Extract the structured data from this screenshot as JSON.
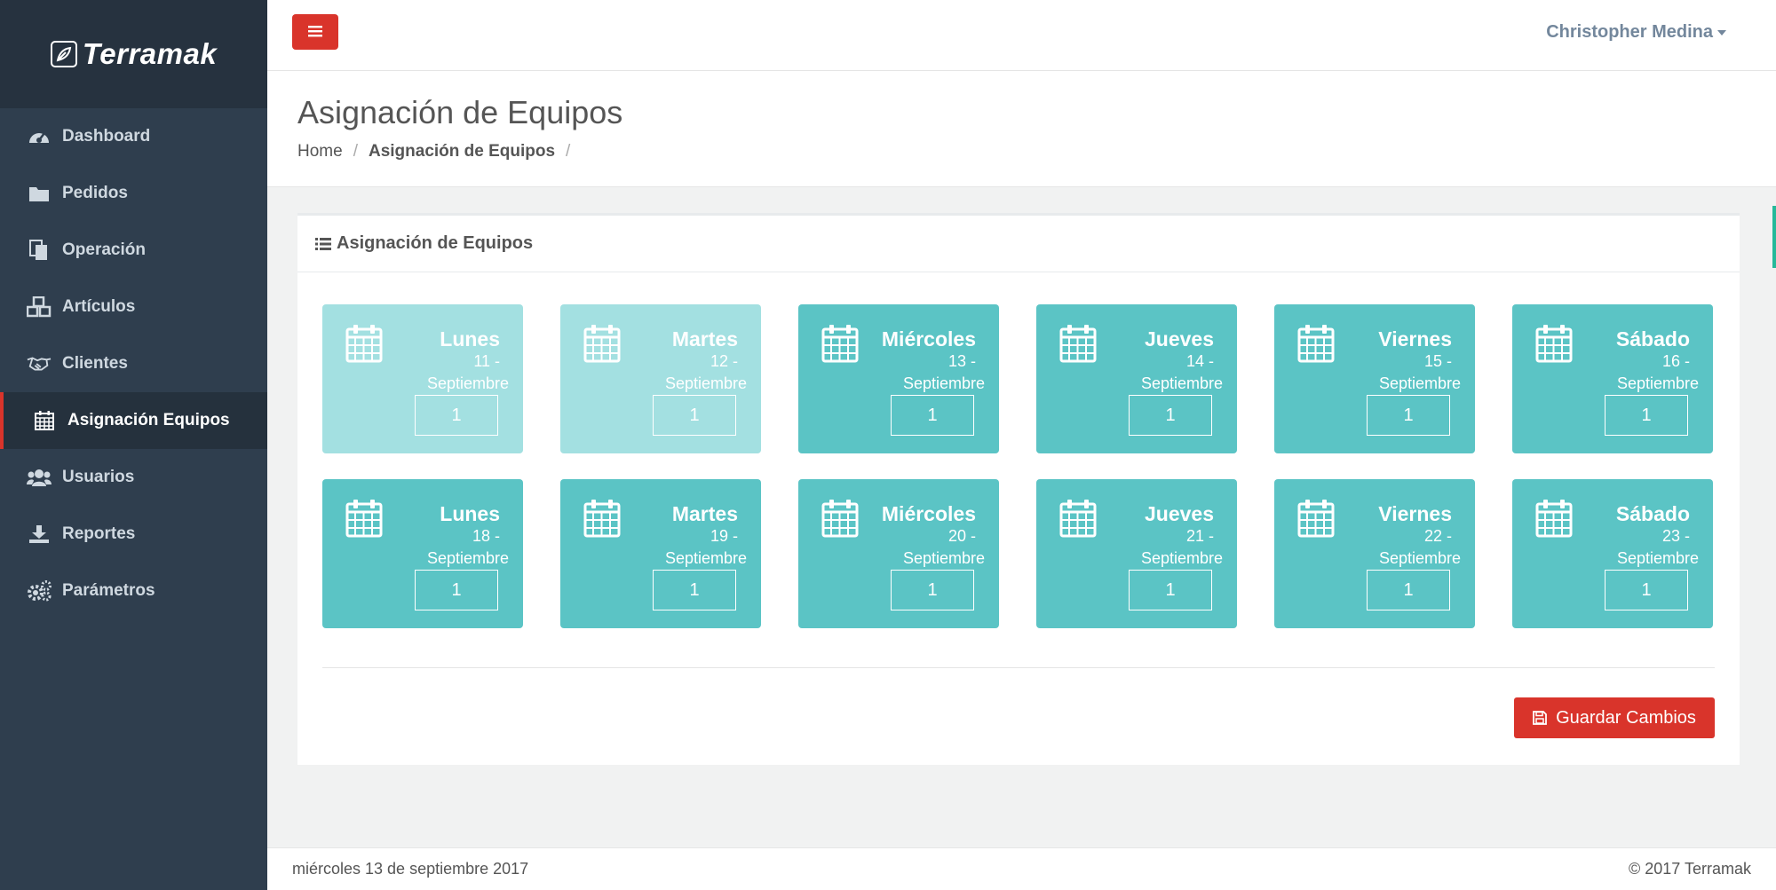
{
  "brand": {
    "name": "Terramak"
  },
  "topbar": {
    "user_name": "Christopher Medina"
  },
  "sidebar": {
    "items": [
      {
        "label": "Dashboard",
        "icon": "dashboard-icon"
      },
      {
        "label": "Pedidos",
        "icon": "folder-icon"
      },
      {
        "label": "Operación",
        "icon": "documents-icon"
      },
      {
        "label": "Artículos",
        "icon": "cubes-icon"
      },
      {
        "label": "Clientes",
        "icon": "handshake-icon"
      },
      {
        "label": "Asignación Equipos",
        "icon": "calendar-icon",
        "active": true
      },
      {
        "label": "Usuarios",
        "icon": "users-icon"
      },
      {
        "label": "Reportes",
        "icon": "download-icon"
      },
      {
        "label": "Parámetros",
        "icon": "gears-icon"
      }
    ]
  },
  "page": {
    "title": "Asignación de Equipos",
    "breadcrumb": {
      "home": "Home",
      "current": "Asignación de Equipos",
      "sep": "/"
    }
  },
  "panel": {
    "title": "Asignación de Equipos",
    "days": [
      {
        "name": "Lunes",
        "num": "11 -",
        "month": "Septiembre",
        "value": "1",
        "past": true
      },
      {
        "name": "Martes",
        "num": "12 -",
        "month": "Septiembre",
        "value": "1",
        "past": true
      },
      {
        "name": "Miércoles",
        "num": "13 -",
        "month": "Septiembre",
        "value": "1",
        "past": false
      },
      {
        "name": "Jueves",
        "num": "14 -",
        "month": "Septiembre",
        "value": "1",
        "past": false
      },
      {
        "name": "Viernes",
        "num": "15 -",
        "month": "Septiembre",
        "value": "1",
        "past": false
      },
      {
        "name": "Sábado",
        "num": "16 -",
        "month": "Septiembre",
        "value": "1",
        "past": false
      },
      {
        "name": "Lunes",
        "num": "18 -",
        "month": "Septiembre",
        "value": "1",
        "past": false
      },
      {
        "name": "Martes",
        "num": "19 -",
        "month": "Septiembre",
        "value": "1",
        "past": false
      },
      {
        "name": "Miércoles",
        "num": "20 -",
        "month": "Septiembre",
        "value": "1",
        "past": false
      },
      {
        "name": "Jueves",
        "num": "21 -",
        "month": "Septiembre",
        "value": "1",
        "past": false
      },
      {
        "name": "Viernes",
        "num": "22 -",
        "month": "Septiembre",
        "value": "1",
        "past": false
      },
      {
        "name": "Sábado",
        "num": "23 -",
        "month": "Septiembre",
        "value": "1",
        "past": false
      }
    ],
    "save_label": "Guardar Cambios"
  },
  "footer": {
    "date": "miércoles 13 de septiembre 2017",
    "copyright": "© 2017 Terramak"
  },
  "colors": {
    "accent_red": "#d9342b",
    "tile_teal": "#5bc4c5",
    "tile_past": "#a3e0e1",
    "sidebar_bg": "#2f3e4e"
  }
}
